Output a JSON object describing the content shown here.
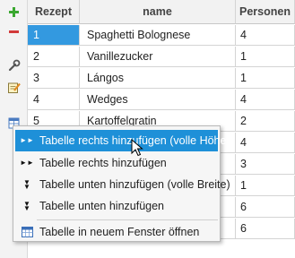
{
  "toolbar": {
    "buttons": [
      {
        "icon": "add-icon"
      },
      {
        "icon": "remove-icon"
      },
      {
        "icon": "wrench-icon"
      },
      {
        "icon": "edit-icon"
      },
      {
        "icon": "table-icon"
      }
    ]
  },
  "grid": {
    "columns": [
      "Rezept",
      "name",
      "Personen"
    ],
    "rows": [
      {
        "rezept": "1",
        "name": "Spaghetti Bolognese",
        "personen": "4"
      },
      {
        "rezept": "2",
        "name": "Vanillezucker",
        "personen": "1"
      },
      {
        "rezept": "3",
        "name": "Lángos",
        "personen": "1"
      },
      {
        "rezept": "4",
        "name": "Wedges",
        "personen": "4"
      },
      {
        "rezept": "5",
        "name": "Kartoffelgratin",
        "personen": "2"
      },
      {
        "rezept": "",
        "name": "",
        "personen": "4"
      },
      {
        "rezept": "",
        "name": "",
        "personen": "3"
      },
      {
        "rezept": "",
        "name": "",
        "personen": "1"
      },
      {
        "rezept": "",
        "name": "",
        "personen": "6"
      },
      {
        "rezept": "",
        "name": "",
        "personen": "6"
      }
    ],
    "selected_row_index": 0
  },
  "context_menu": {
    "items": [
      {
        "label": "Tabelle rechts hinzufügen (volle Höhe)",
        "icon": "double-arrow-right-icon",
        "highlighted": true
      },
      {
        "label": "Tabelle rechts hinzufügen",
        "icon": "double-arrow-right-icon"
      },
      {
        "label": "Tabelle unten hinzufügen (volle Breite)",
        "icon": "double-arrow-down-icon"
      },
      {
        "label": "Tabelle unten hinzufügen",
        "icon": "double-arrow-down-icon"
      },
      {
        "label": "Tabelle in neuem Fenster öffnen",
        "icon": "window-icon"
      }
    ]
  },
  "colors": {
    "selection": "#3399e0",
    "menu_highlight": "#1e90d8",
    "add_green": "#3aa830",
    "remove_red": "#d23a3a"
  }
}
